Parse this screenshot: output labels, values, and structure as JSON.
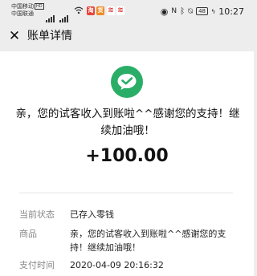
{
  "status_bar": {
    "carrier_1": "中国移动",
    "carrier_1_badge": "HD",
    "carrier_2": "中国联通",
    "time": "10:27",
    "battery": "48"
  },
  "header": {
    "title": "账单详情"
  },
  "detail": {
    "remark": "亲，您的试客收入到账啦^^感谢您的支持！继续加油哦！",
    "amount": "+100.00"
  },
  "rows": [
    {
      "label": "当前状态",
      "value": "已存入零钱"
    },
    {
      "label": "商品",
      "value": "亲，您的试客收入到账啦^^感谢您的支持！继续加油哦！"
    },
    {
      "label": "支付时间",
      "value": "2020-04-09 20:16:32"
    }
  ],
  "colors": {
    "wechat_green": "#2aae67",
    "background": "#ededed"
  }
}
